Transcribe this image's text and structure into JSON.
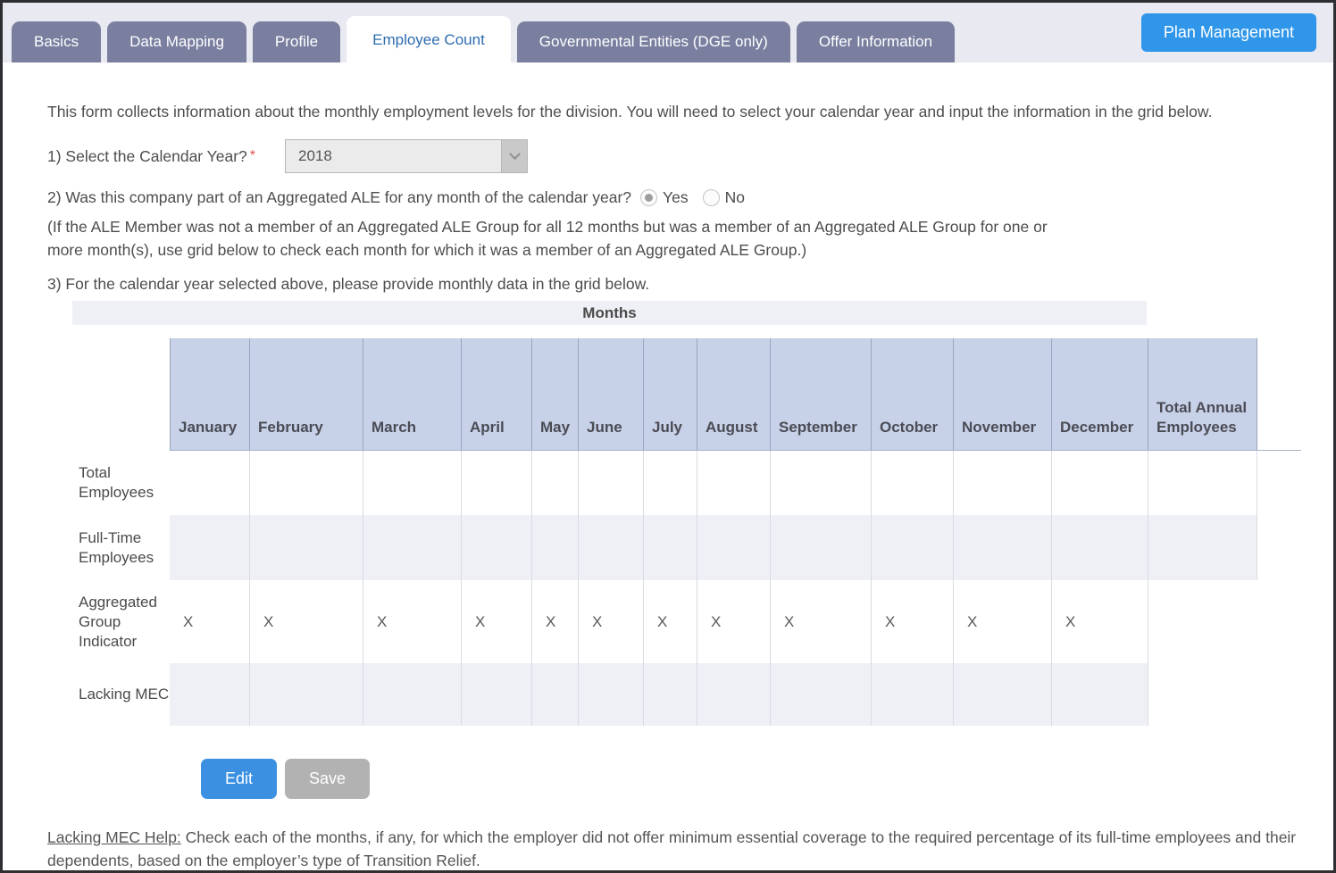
{
  "tabs": [
    {
      "label": "Basics"
    },
    {
      "label": "Data Mapping"
    },
    {
      "label": "Profile"
    },
    {
      "label": "Employee Count"
    },
    {
      "label": "Governmental Entities (DGE only)"
    },
    {
      "label": "Offer Information"
    }
  ],
  "active_tab_index": 3,
  "plan_management_button": "Plan Management",
  "intro": "This form collects information about the monthly employment levels for the division. You will need to select your calendar year and input the information in the grid below.",
  "q1": {
    "label": "1) Select the Calendar Year?",
    "required_marker": "*",
    "value": "2018"
  },
  "q2": {
    "label": "2) Was this company part of an Aggregated ALE for any month of the calendar year?",
    "options": [
      "Yes",
      "No"
    ],
    "selected": "Yes",
    "note": "(If the ALE Member was not a member of an Aggregated ALE Group for all 12 months but was a member of an Aggregated ALE Group for one or more month(s), use grid below to check each month for which it was a member of an Aggregated ALE Group.)"
  },
  "q3": "3) For the calendar year selected above, please provide monthly data in the grid below.",
  "grid": {
    "months_header": "Months",
    "columns": [
      "January",
      "February",
      "March",
      "April",
      "May",
      "June",
      "July",
      "August",
      "September",
      "October",
      "November",
      "December",
      "Total Annual Employees"
    ],
    "rows": [
      {
        "label": "Total Employees",
        "cells": [
          "",
          "",
          "",
          "",
          "",
          "",
          "",
          "",
          "",
          "",
          "",
          ""
        ],
        "has_total_col": true
      },
      {
        "label": "Full-Time Employees",
        "cells": [
          "",
          "",
          "",
          "",
          "",
          "",
          "",
          "",
          "",
          "",
          "",
          ""
        ],
        "has_total_col": true
      },
      {
        "label": "Aggregated Group Indicator",
        "cells": [
          "X",
          "X",
          "X",
          "X",
          "X",
          "X",
          "X",
          "X",
          "X",
          "X",
          "X",
          "X"
        ],
        "has_total_col": false
      },
      {
        "label": "Lacking MEC",
        "cells": [
          "",
          "",
          "",
          "",
          "",
          "",
          "",
          "",
          "",
          "",
          "",
          ""
        ],
        "has_total_col": false
      }
    ]
  },
  "buttons": {
    "edit": "Edit",
    "save": "Save"
  },
  "help": {
    "title": "Lacking MEC Help:",
    "text": "Check each of the months, if any, for which the employer did not offer minimum essential coverage to the required percentage of its full-time employees and their dependents, based on the employer’s type of Transition Relief."
  },
  "colors": {
    "accent_blue": "#2f96ea",
    "tab_inactive": "#7a7fa0",
    "active_tab_text": "#2d6cb0",
    "grid_header_blue": "#c7d2e8",
    "alt_row_gray": "#eef0f6",
    "months_bar_gray": "#eff0f5",
    "save_disabled_gray": "#b2b2b2",
    "required_red": "#d9534f"
  }
}
